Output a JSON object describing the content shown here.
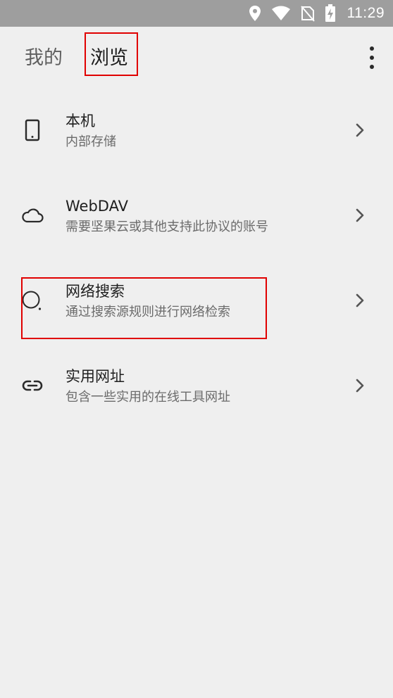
{
  "status_bar": {
    "time": "11:29",
    "icons": [
      "location-icon",
      "wifi-icon",
      "no-sim-icon",
      "battery-charging-icon"
    ]
  },
  "tabs": {
    "mine": "我的",
    "browse": "浏览",
    "selected": "browse"
  },
  "list": {
    "items": [
      {
        "icon": "phone-icon",
        "title": "本机",
        "subtitle": "内部存储"
      },
      {
        "icon": "cloud-icon",
        "title": "WebDAV",
        "subtitle": "需要坚果云或其他支持此协议的账号"
      },
      {
        "icon": "search-icon",
        "title": "网络搜索",
        "subtitle": "通过搜索源规则进行网络检索"
      },
      {
        "icon": "link-icon",
        "title": "实用网址",
        "subtitle": "包含一些实用的在线工具网址"
      }
    ]
  },
  "colors": {
    "status_bar_bg": "#9e9e9e",
    "background": "#efefef",
    "highlight_border": "#e00000"
  }
}
